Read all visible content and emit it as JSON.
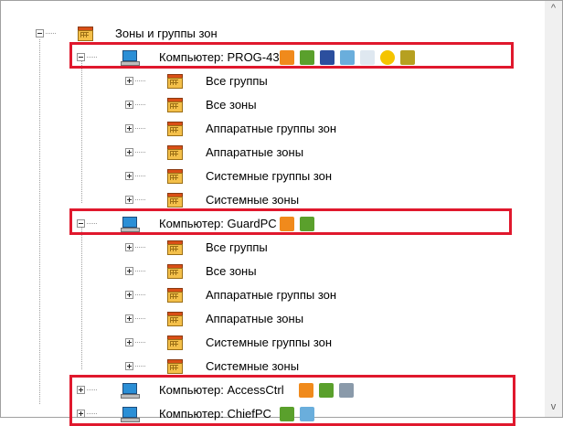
{
  "tree": {
    "root": {
      "label": "Зоны и группы зон"
    },
    "computers": [
      {
        "label": "Компьютер: PROG-43",
        "icons": [
          "arrow-pointer-icon",
          "device-icon",
          "monitor-icon",
          "document-icon",
          "clock-icon",
          "sun-icon",
          "keys-icon"
        ],
        "children": [
          "Все группы",
          "Все зоны",
          "Аппаратные группы зон",
          "Аппаратные зоны",
          "Системные группы зон",
          "Системные зоны"
        ]
      },
      {
        "label": "Компьютер: GuardPC",
        "icons": [
          "arrow-pointer-icon",
          "device-icon"
        ],
        "children": [
          "Все группы",
          "Все зоны",
          "Аппаратные группы зон",
          "Аппаратные зоны",
          "Системные группы зон",
          "Системные зоны"
        ]
      },
      {
        "label": "Компьютер: AccessCtrl",
        "icons": [
          "arrow-pointer-icon",
          "device-icon",
          "camera-icon"
        ],
        "children": []
      },
      {
        "label": "Компьютер: ChiefPC",
        "icons": [
          "device-icon",
          "document-icon"
        ],
        "children": []
      }
    ]
  },
  "colors": {
    "highlight": "#e0182d",
    "folder": "#f4c04a",
    "computer": "#2b8fd6"
  },
  "scrollbar": {
    "up_arrow": "^",
    "down_arrow": "v"
  }
}
